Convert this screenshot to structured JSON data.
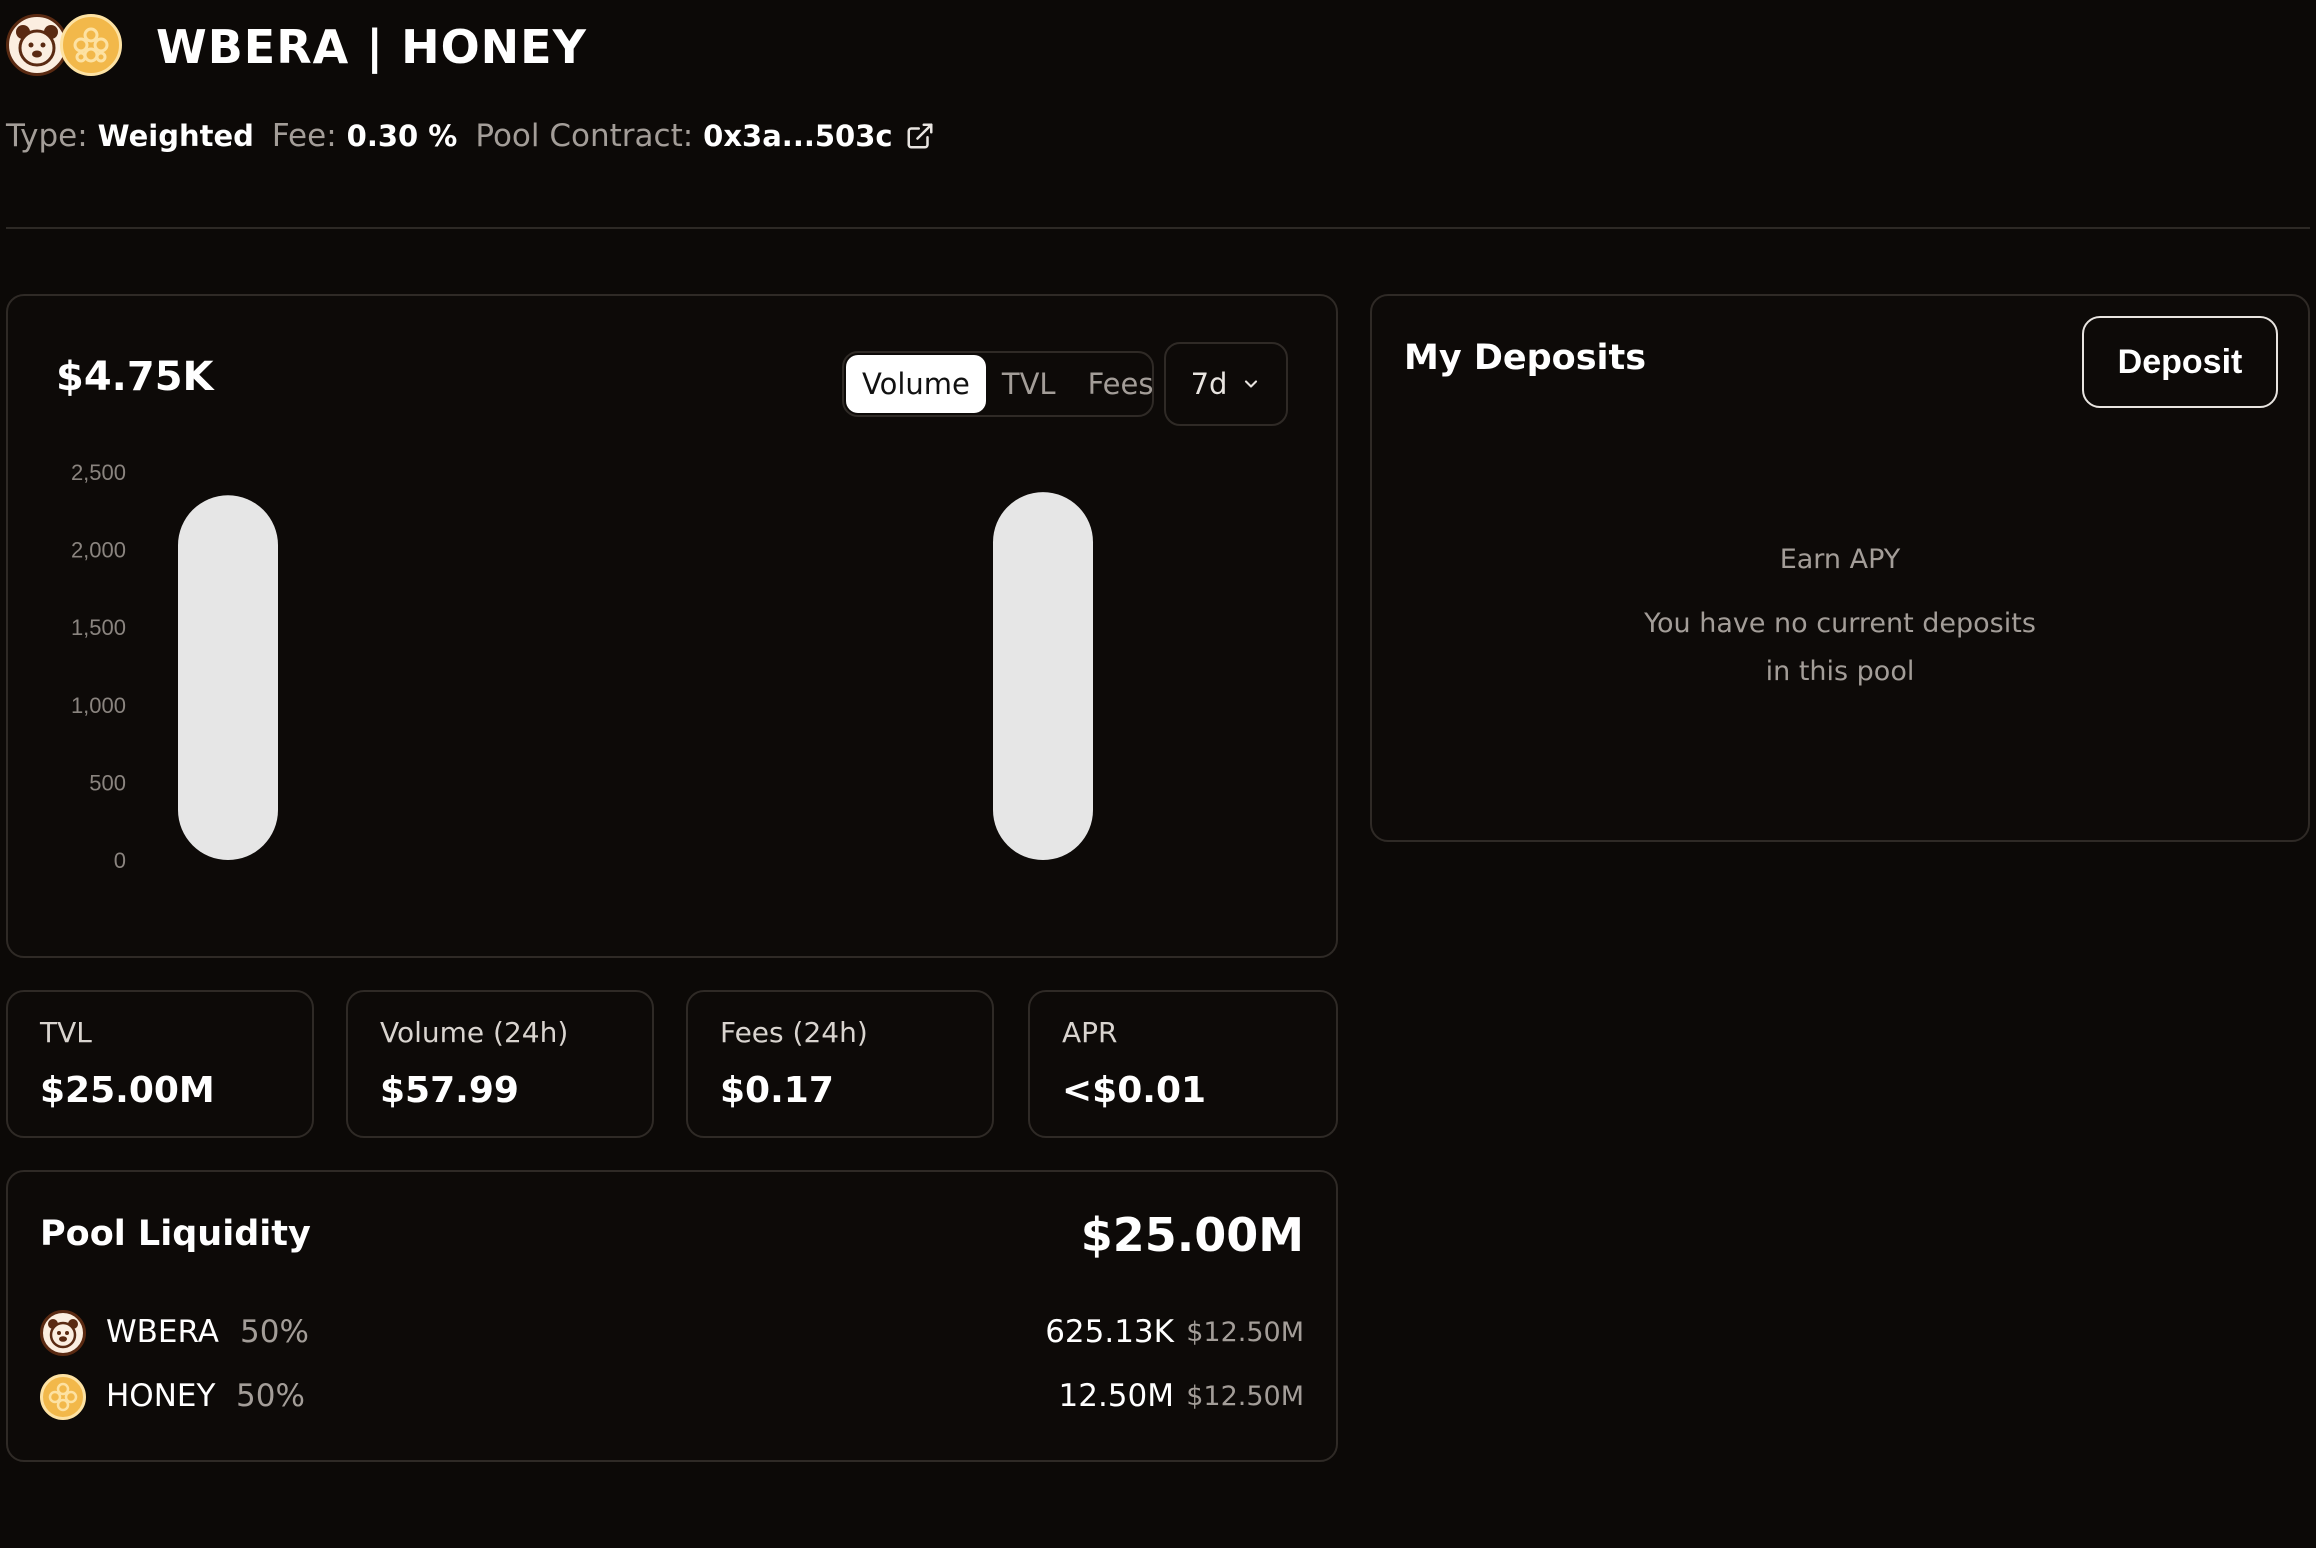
{
  "header": {
    "title": "WBERA | HONEY",
    "type_label": "Type:",
    "type_value": "Weighted",
    "fee_label": "Fee:",
    "fee_value": "0.30 %",
    "contract_label": "Pool Contract:",
    "contract_value": "0x3a...503c",
    "icons": [
      "wbera-bear-icon",
      "honey-comb-icon",
      "external-link-icon"
    ]
  },
  "chart_panel": {
    "headline_value": "$4.75K",
    "tabs": [
      {
        "label": "Volume",
        "active": true
      },
      {
        "label": "TVL",
        "active": false
      },
      {
        "label": "Fees",
        "active": false
      }
    ],
    "range_select": {
      "value": "7d",
      "icon": "chevron-down-icon"
    }
  },
  "chart_data": {
    "type": "bar",
    "categories": [
      "",
      ""
    ],
    "values": [
      2350,
      2370
    ],
    "ylim": [
      0,
      2500
    ],
    "yticks": [
      "2,500",
      "2,000",
      "1,500",
      "1,000",
      "500",
      "0"
    ],
    "ytick_values": [
      2500,
      2000,
      1500,
      1000,
      500,
      0
    ],
    "grid": false,
    "bar_color": "#e6e6e6"
  },
  "stats": [
    {
      "label": "TVL",
      "value": "$25.00M"
    },
    {
      "label": "Volume (24h)",
      "value": "$57.99"
    },
    {
      "label": "Fees (24h)",
      "value": "$0.17"
    },
    {
      "label": "APR",
      "value": "<$0.01"
    }
  ],
  "liquidity": {
    "title": "Pool Liquidity",
    "total": "$25.00M",
    "tokens": [
      {
        "name": "WBERA",
        "pct": "50%",
        "amount": "625.13K",
        "usd": "$12.50M",
        "icon": "wbera-bear-icon"
      },
      {
        "name": "HONEY",
        "pct": "50%",
        "amount": "12.50M",
        "usd": "$12.50M",
        "icon": "honey-comb-icon"
      }
    ]
  },
  "deposits": {
    "title": "My Deposits",
    "button_label": "Deposit",
    "earn_label": "Earn APY",
    "empty_line1": "You have no current deposits",
    "empty_line2": "in this pool"
  },
  "colors": {
    "background": "#0c0907",
    "card_border": "#2f2a26",
    "muted_text": "#a39d98",
    "honey": "#f2b84a",
    "bar": "#e6e6e6"
  }
}
